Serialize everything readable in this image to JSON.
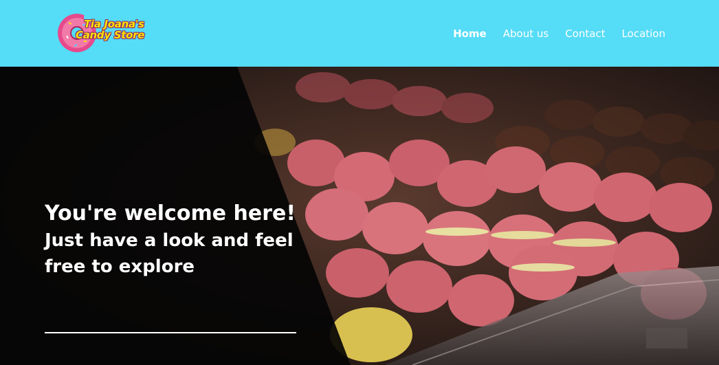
{
  "brand": {
    "logo_line1": "Tia Joana's",
    "logo_line2": "Candy Store",
    "color_header": "#55dcf6",
    "color_logo_text": "#ffe400"
  },
  "nav": {
    "items": [
      {
        "label": "Home",
        "active": true
      },
      {
        "label": "About us",
        "active": false
      },
      {
        "label": "Contact",
        "active": false
      },
      {
        "label": "Location",
        "active": false
      }
    ]
  },
  "hero": {
    "title": "You're welcome here!",
    "subtitle": "Just have a look and feel free to explore",
    "background_icon": "macarons-photo"
  }
}
